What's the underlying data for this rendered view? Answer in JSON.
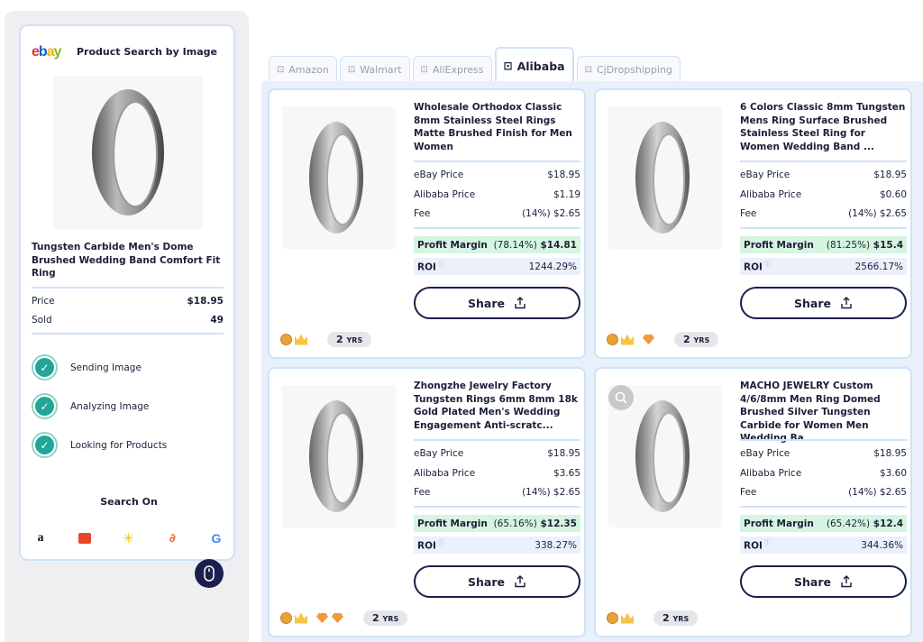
{
  "sidebar": {
    "logo": [
      "e",
      "b",
      "a",
      "y"
    ],
    "logo_colors": [
      "#e53238",
      "#0064d2",
      "#f5af02",
      "#86b817"
    ],
    "title": "Product Search by Image",
    "product_title": "Tungsten Carbide Men's Dome Brushed Wedding Band Comfort Fit Ring",
    "price_label": "Price",
    "price_value": "$18.95",
    "sold_label": "Sold",
    "sold_value": "49",
    "steps": [
      "Sending Image",
      "Analyzing Image",
      "Looking for Products"
    ],
    "search_on_label": "Search On",
    "search_icons": [
      "amazon-icon",
      "aliexpress-icon",
      "walmart-icon",
      "alibaba-icon",
      "google-icon"
    ]
  },
  "tabs": [
    {
      "label": "Amazon",
      "icon": "amazon-tab-icon",
      "active": false
    },
    {
      "label": "Walmart",
      "icon": "walmart-tab-icon",
      "active": false
    },
    {
      "label": "AliExpress",
      "icon": "aliexpress-tab-icon",
      "active": false
    },
    {
      "label": "Alibaba",
      "icon": "alibaba-tab-icon",
      "active": true
    },
    {
      "label": "CjDropshipping",
      "icon": "cjdropshipping-tab-icon",
      "active": false
    }
  ],
  "labels": {
    "ebay_price": "eBay Price",
    "alibaba_price": "Alibaba Price",
    "fee": "Fee",
    "profit_margin": "Profit Margin",
    "roi": "ROI",
    "share": "Share",
    "yrs_unit": "YRS"
  },
  "results": [
    {
      "title": "Wholesale Orthodox Classic 8mm Stainless Steel Rings Matte Brushed Finish for Men Women",
      "ebay_price": "$18.95",
      "alibaba_price": "$1.19",
      "fee": "(14%) $2.65",
      "profit_pct": "(78.14%)",
      "profit_value": "$14.81",
      "roi": "1244.29%",
      "years": "2",
      "diamonds": 0
    },
    {
      "title": "6 Colors Classic 8mm Tungsten Mens Ring Surface Brushed Stainless Steel Ring for Women Wedding Band ...",
      "ebay_price": "$18.95",
      "alibaba_price": "$0.60",
      "fee": "(14%) $2.65",
      "profit_pct": "(81.25%)",
      "profit_value": "$15.4",
      "roi": "2566.17%",
      "years": "2",
      "diamonds": 1
    },
    {
      "title": "Zhongzhe Jewelry Factory Tungsten Rings 6mm 8mm 18k Gold Plated Men's Wedding Engagement Anti-scratc...",
      "ebay_price": "$18.95",
      "alibaba_price": "$3.65",
      "fee": "(14%) $2.65",
      "profit_pct": "(65.16%)",
      "profit_value": "$12.35",
      "roi": "338.27%",
      "years": "2",
      "diamonds": 2
    },
    {
      "title": "MACHO JEWELRY Custom 4/6/8mm Men Ring Domed Brushed Silver Tungsten Carbide for Women Men Wedding Ba...",
      "ebay_price": "$18.95",
      "alibaba_price": "$3.60",
      "fee": "(14%) $2.65",
      "profit_pct": "(65.42%)",
      "profit_value": "$12.4",
      "roi": "344.36%",
      "years": "2",
      "diamonds": 0
    }
  ]
}
